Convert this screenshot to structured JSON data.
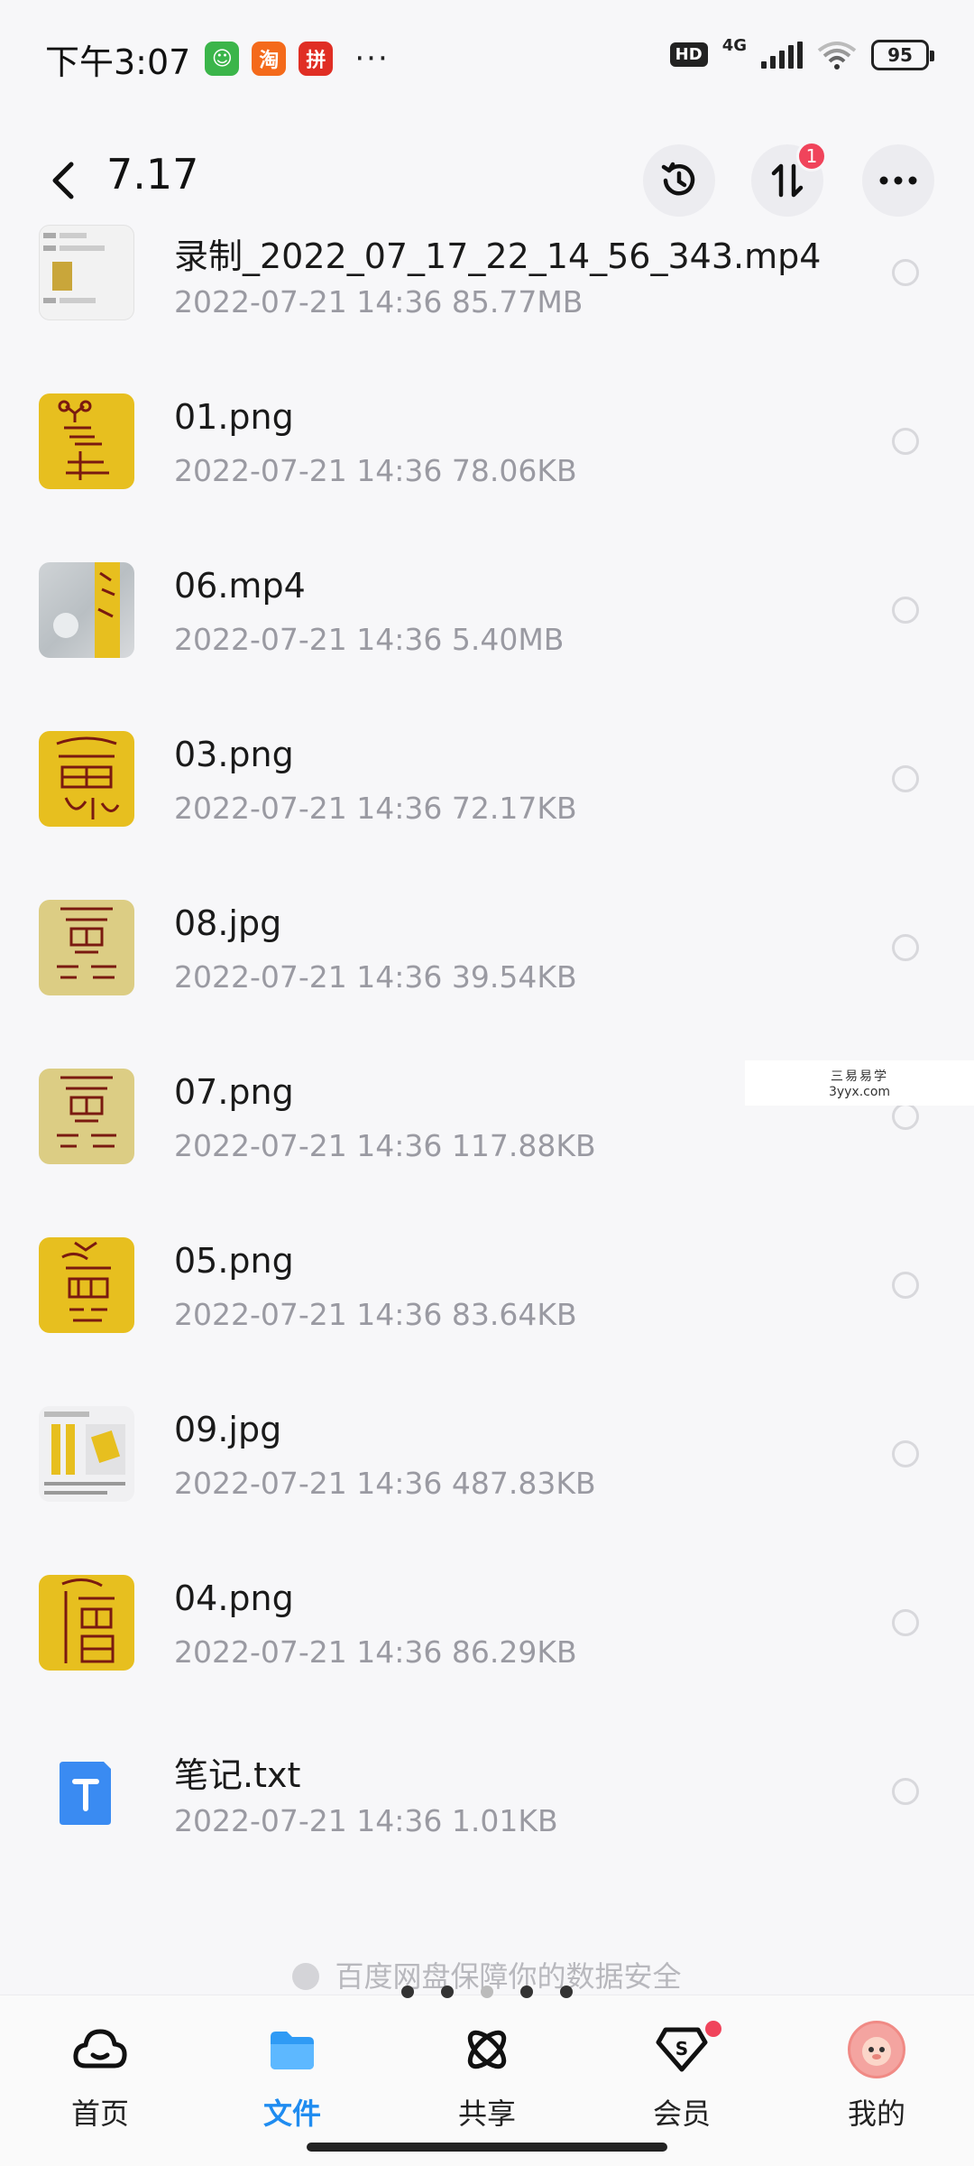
{
  "status_bar": {
    "time": "下午3:07",
    "app_icons": [
      {
        "name": "wechat-icon",
        "color": "#3bb54a",
        "glyph": "☺"
      },
      {
        "name": "taobao-icon",
        "color": "#f46a1b",
        "glyph": "淘"
      },
      {
        "name": "pinduoduo-icon",
        "color": "#e02e24",
        "glyph": "拼"
      }
    ],
    "more": "···",
    "hd": "HD",
    "network": "4G",
    "battery": "95"
  },
  "header": {
    "title": "7.17",
    "notification_count": "1"
  },
  "files": [
    {
      "name": "录制_2022_07_17_22_14_56_343.mp4",
      "meta": "2022-07-21  14:36  85.77MB",
      "thumb": "video1"
    },
    {
      "name": "01.png",
      "meta": "2022-07-21  14:36  78.06KB",
      "thumb": "yellow"
    },
    {
      "name": "06.mp4",
      "meta": "2022-07-21  14:36  5.40MB",
      "thumb": "video2"
    },
    {
      "name": "03.png",
      "meta": "2022-07-21  14:36  72.17KB",
      "thumb": "yellow"
    },
    {
      "name": "08.jpg",
      "meta": "2022-07-21  14:36  39.54KB",
      "thumb": "paper"
    },
    {
      "name": "07.png",
      "meta": "2022-07-21  14:36  117.88KB",
      "thumb": "paper"
    },
    {
      "name": "05.png",
      "meta": "2022-07-21  14:36  83.64KB",
      "thumb": "yellow"
    },
    {
      "name": "09.jpg",
      "meta": "2022-07-21  14:36  487.83KB",
      "thumb": "doc"
    },
    {
      "name": "04.png",
      "meta": "2022-07-21  14:36  86.29KB",
      "thumb": "yellow"
    },
    {
      "name": "笔记.txt",
      "meta": "2022-07-21  14:36  1.01KB",
      "thumb": "txt"
    }
  ],
  "watermark": {
    "line1": "三易易学",
    "line2": "3yyx.com"
  },
  "safety_notice": "百度网盘保障你的数据安全",
  "bottom_nav": [
    {
      "label": "首页",
      "icon": "cloud-home-icon",
      "active": false
    },
    {
      "label": "文件",
      "icon": "folder-icon",
      "active": true
    },
    {
      "label": "共享",
      "icon": "share-atom-icon",
      "active": false
    },
    {
      "label": "会员",
      "icon": "vip-icon",
      "active": false
    },
    {
      "label": "我的",
      "icon": "avatar",
      "active": false
    }
  ],
  "colors": {
    "accent": "#1f8cf0",
    "badge": "#f0445b",
    "thumb_yellow": "#e7bf1f"
  }
}
